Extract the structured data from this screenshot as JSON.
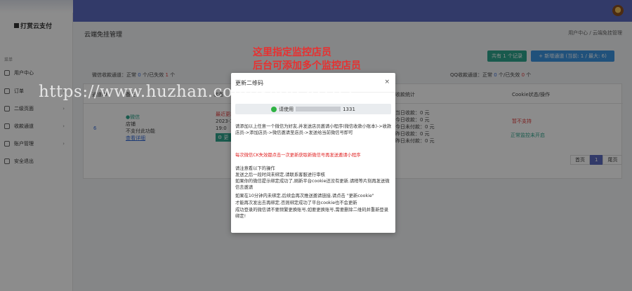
{
  "sidebar": {
    "brand": "打赏云支付",
    "menu_header": "菜单",
    "items": [
      {
        "label": "用户中心",
        "arrow": ""
      },
      {
        "label": "订单",
        "arrow": "›"
      },
      {
        "label": "二级页面",
        "arrow": "›"
      },
      {
        "label": "收款通道",
        "arrow": "›"
      },
      {
        "label": "账户管理",
        "arrow": "›"
      },
      {
        "label": "安全退出",
        "arrow": ""
      }
    ]
  },
  "header": {
    "page_title": "云端免挂管理",
    "breadcrumb": "用户中心 / 云端免挂管理"
  },
  "toolbar": {
    "stats_button": "共有 1 个记录",
    "add_button": "+ 新增通道 (当前: 1 / 最大: 6)"
  },
  "stats": {
    "wx_prefix": "微信收款通道：正常",
    "wx_normal": "0",
    "wx_mid": "个/已失效",
    "wx_invalid": "1",
    "wx_suffix": "个",
    "qq_prefix": "QQ收款通道：正常",
    "qq_normal": "0",
    "qq_mid": "个/已失效",
    "qq_invalid": "0",
    "qq_suffix": "个"
  },
  "table": {
    "headers": [
      "通道ID",
      "备注",
      "状态",
      "收款统计",
      "Cookie状态/操作"
    ],
    "row": {
      "id": "6",
      "status_ok": "●微信",
      "account": "店铺",
      "status_note": "不支付此功能",
      "detail_link": "查看详细",
      "time_label": "最近更新时间",
      "time_val": "2023-1",
      "time_val2": "19:0",
      "op_btn": "⚙ 更",
      "revenue_1": "当日收款：0 元",
      "revenue_2": "今日收款：0 元",
      "revenue_3": "今日未付款：0 元",
      "revenue_4": "昨日收款：0 元",
      "revenue_5": "昨日未付款：0 元",
      "cookie_status": "暂不支持",
      "cookie_action": "正常监控未开启"
    }
  },
  "pagination": {
    "prev": "首页",
    "current": "1",
    "next": "尾页"
  },
  "annotation": {
    "line1": "这里指定监控店员",
    "line2": "后台可添加多个监控店员"
  },
  "modal": {
    "title": "更新二维码",
    "close": "×",
    "qr_prefix": "请使用",
    "qr_suffix": "1331",
    "instructions": "请添加以上任意一个微信为好友,并发送店员邀请小程序(微信收款小账本)->收款店员->添加店员->微信邀请至店员->发送给当前微信号即可",
    "warning": "每次微信CK失效都点击一次更新获取新微信号再发送邀请小程序",
    "steps_title": "请注意看以下的操作",
    "step1": "发送之后一段时间未绑定,请联系客服进行审核",
    "step2": "如果你的微信提示绑定成功了,刷新平台cookie还没有更新,请稍等片刻再发送微信去邀请",
    "step3": "如果在10分钟内未绑定,后续会再次推送邀请链接,请点击 \"更新cookie\"",
    "step4": "才能再次发出去再绑定,否则绑定成功了平台cookie也不会更新",
    "step5": "成功登录的微信请不要频繁更换账号,如要更换账号,需要删除二维码并重新登录绑定!"
  },
  "watermark": "https://www.huzhan.com/ishop50103"
}
